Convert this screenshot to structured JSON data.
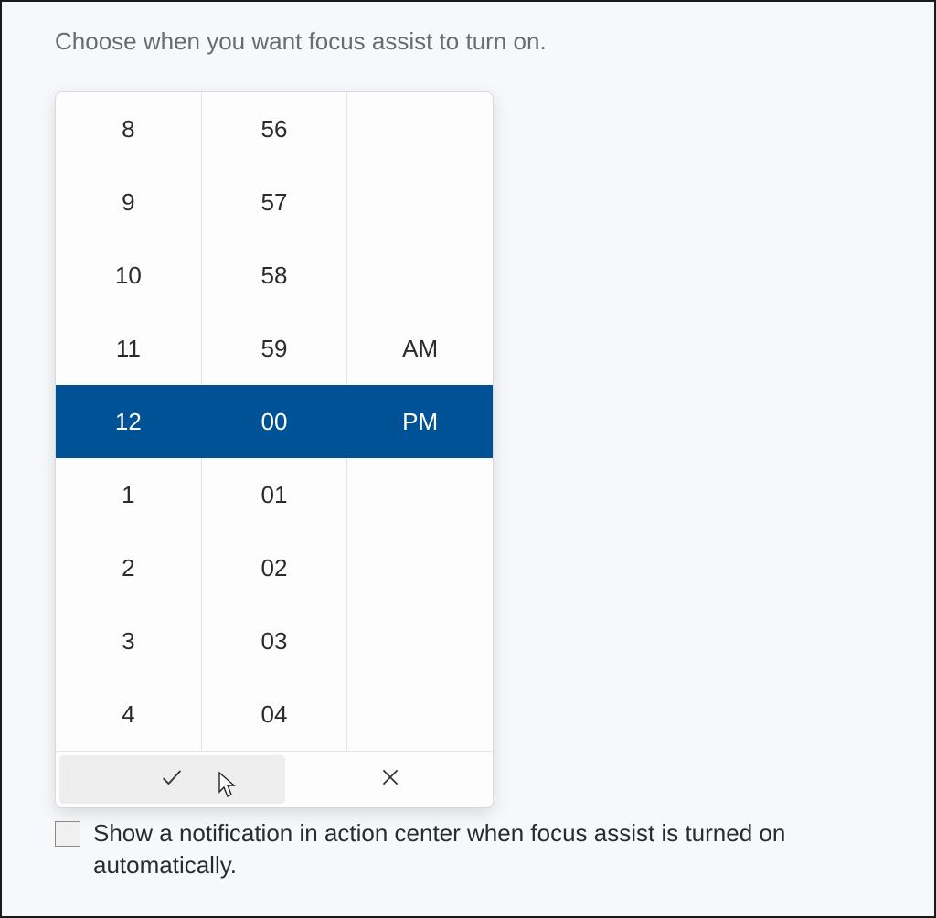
{
  "heading": "Choose when you want focus assist to turn on.",
  "picker": {
    "hours": [
      "8",
      "9",
      "10",
      "11",
      "12",
      "1",
      "2",
      "3",
      "4"
    ],
    "minutes": [
      "56",
      "57",
      "58",
      "59",
      "00",
      "01",
      "02",
      "03",
      "04"
    ],
    "ampm": [
      "",
      "",
      "",
      "AM",
      "PM",
      "",
      "",
      "",
      ""
    ],
    "selected_index": 4
  },
  "actions": {
    "confirm_icon": "check-icon",
    "cancel_icon": "close-icon"
  },
  "checkbox": {
    "checked": false,
    "label": "Show a notification in action center when focus assist is turned on automatically."
  }
}
